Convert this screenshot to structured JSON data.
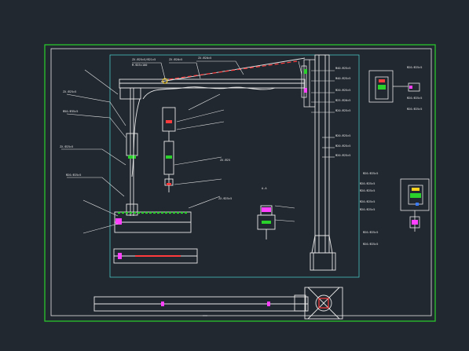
{
  "drawing": {
    "background_color": "#212830",
    "frame_color": "#2bd12b",
    "line_color": "#4dd6d6",
    "text_color": "#e8e8e8",
    "accent_red": "#ff3b3b",
    "accent_magenta": "#ff40ff",
    "accent_yellow": "#ffd21f",
    "accent_green": "#2bd12b",
    "accent_blue": "#3b7bff"
  },
  "labels": {
    "top_callout_1": "ZX-Ф25×5/Ф21×5",
    "top_callout_2": "ZX-Ф20×5",
    "top_callout_3": "ZX-Ф20×5",
    "top_callout_4": "M-Ф25×100",
    "left_1": "ZX-Ф25×5",
    "left_2": "Ф50-Ф35×5",
    "left_3": "ZX-Ф25×5",
    "left_4": "Ф20-Ф25×5",
    "mid_1": "ZX-Ф25",
    "mid_2": "ZX-Ф25×5",
    "mid_3": "A-A",
    "right_1": "Ф40-Ф25×5",
    "right_2": "Ф40-Ф25×5",
    "right_3": "Ф20-Ф25×5",
    "right_4": "Ф25-Ф20×5",
    "right_5": "Ф20-Ф25×5",
    "right_6": "Ф20-Ф25×5",
    "right_7": "Ф20-Ф25×5",
    "right_8": "Ф20-Ф25×5",
    "detail_a_1": "Ф20-Ф25×5",
    "detail_a_2": "Ф20-Ф25×5",
    "detail_a_3": "Ф20-Ф25×5",
    "detail_b_1": "Ф20-Ф25×5",
    "detail_b_2": "Ф20-Ф25×5",
    "detail_b_3": "Ф20-Ф25×5",
    "detail_b_4": "Ф20-Ф25×5",
    "detail_b_5": "Ф20-Ф25×5",
    "detail_b_6": "Ф20-Ф25×5",
    "detail_b_7": "Ф20-Ф25×5"
  }
}
